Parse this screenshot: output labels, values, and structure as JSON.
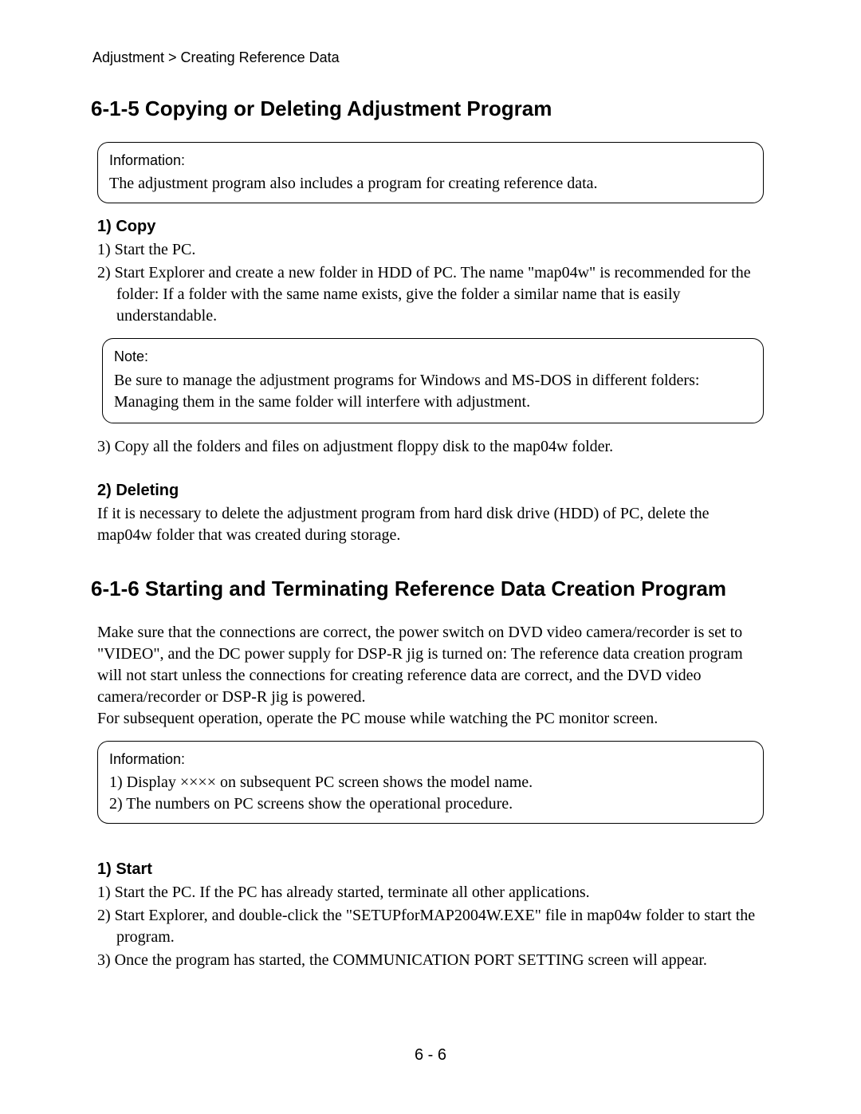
{
  "breadcrumb": "Adjustment > Creating Reference Data",
  "section_6_1_5": {
    "heading": "6-1-5  Copying or Deleting Adjustment Program",
    "info": {
      "label": "Information:",
      "body": "The adjustment program also includes a program for creating reference data."
    },
    "copy": {
      "heading": "1)  Copy",
      "item1": "1) Start the PC.",
      "item2": "2) Start Explorer and create a new folder in HDD of PC. The name \"map04w\" is recommended for the folder: If a folder with the same name exists, give the folder a similar name that is easily understandable.",
      "note": {
        "label": "Note:",
        "body": "Be sure to manage the adjustment programs for Windows and MS-DOS in different folders: Managing them in the same folder will interfere with adjustment."
      },
      "item3": "3) Copy all the folders and files on adjustment floppy disk to the map04w folder."
    },
    "deleting": {
      "heading": "2)  Deleting",
      "body": "If it is necessary to delete the adjustment program from hard disk drive (HDD) of PC, delete the map04w folder that was created during storage."
    }
  },
  "section_6_1_6": {
    "heading": "6-1-6  Starting and Terminating Reference Data Creation Program",
    "intro1": "Make sure that the connections are correct, the power switch on DVD video camera/recorder is set to \"VIDEO\", and the DC power supply for DSP-R jig is turned on: The reference data creation program will not start unless the connections for creating reference data are correct, and the DVD video camera/recorder or DSP-R jig is powered.",
    "intro2": "For subsequent operation, operate the PC mouse while watching the PC monitor screen.",
    "info": {
      "label": "Information:",
      "line1": "1) Display ×××× on subsequent PC screen shows the model name.",
      "line2": "2) The numbers on PC screens show the operational procedure."
    },
    "start": {
      "heading": "1)  Start",
      "item1": "1) Start the PC. If the PC has already started, terminate all other applications.",
      "item2": "2) Start Explorer, and double-click the \"SETUPforMAP2004W.EXE\" file in map04w folder to start the program.",
      "item3": "3) Once the program has started, the COMMUNICATION PORT SETTING screen will appear."
    }
  },
  "page_number": "6 - 6"
}
